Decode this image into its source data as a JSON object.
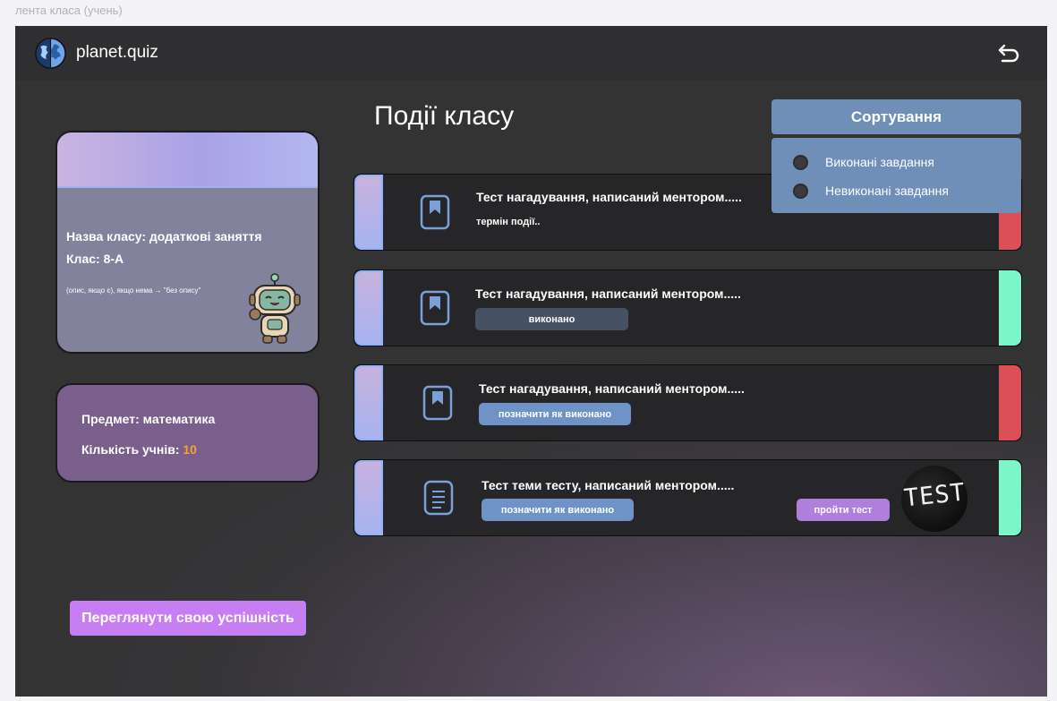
{
  "frame_caption": "лента класа (учень)",
  "header": {
    "brand": "planet.quiz",
    "logo_icon": "brain-globe-icon",
    "back_icon": "undo-arrow-icon"
  },
  "page_title": "Події класу",
  "class_card": {
    "name": "Назва класу: додаткові заняття",
    "grade": "Клас: 8-А",
    "description": "(опис, якщо є), якщо нема → \"без опису\"",
    "mascot_icon": "robot-mascot-icon"
  },
  "subject_card": {
    "subject": "Предмет: математика",
    "students_label": "Кількість учнів: ",
    "students_count": "10"
  },
  "performance_button": "Переглянути свою успішність",
  "sort": {
    "button_label": "Сортування",
    "options": [
      {
        "label": "Виконані завдання"
      },
      {
        "label": "Невиконані завдання"
      }
    ]
  },
  "events": [
    {
      "title": "Тест нагадування, написаний ментором.....",
      "subtitle": "термін події..",
      "status_color": "#dd4f57",
      "icon": "bookmark-icon"
    },
    {
      "title": "Тест нагадування, написаний ментором.....",
      "done_label": "виконано",
      "status_color": "#7cf5c8",
      "icon": "bookmark-icon"
    },
    {
      "title": "Тест нагадування, написаний ментором.....",
      "mark_label": "позначити як виконано",
      "status_color": "#dd4f57",
      "icon": "bookmark-icon"
    },
    {
      "title": "Тест теми тесту, написаний ментором.....",
      "mark_label": "позначити як виконано",
      "test_label": "пройти тест",
      "thumb_text": "TEST",
      "status_color": "#7cf5c8",
      "icon": "document-icon"
    }
  ]
}
